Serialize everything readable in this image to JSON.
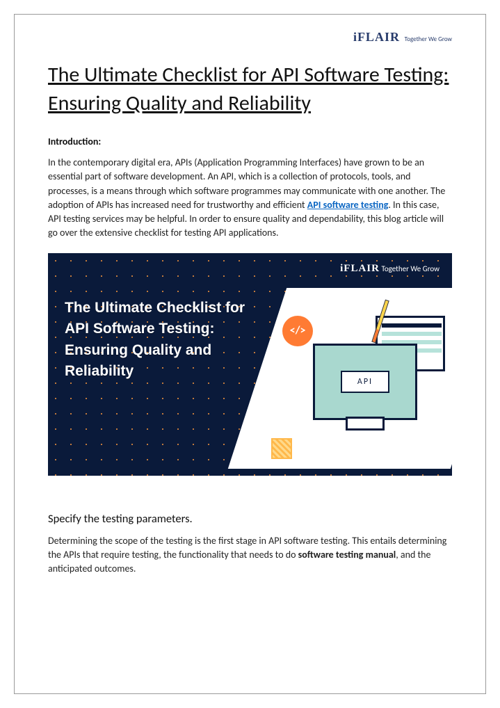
{
  "brand": {
    "name": "iFLAIR",
    "tagline": "Together We Grow"
  },
  "title": "The Ultimate Checklist for API Software Testing: Ensuring Quality and Reliability",
  "intro_label": "Introduction:",
  "intro": {
    "p1a": "In the contemporary digital era, APIs (Application Programming Interfaces) have grown to be an essential part of software development. An API, which is a collection of protocols, tools, and processes, is a means through which software programmes may communicate with one another. The adoption of APIs has increased need for trustworthy and efficient ",
    "link": "API software testing",
    "p1b": ". In this case, API testing services may be helpful. In order to ensure quality and dependability, this blog article will go over the extensive checklist for testing API applications."
  },
  "banner": {
    "title": "The Ultimate Checklist for API Software Testing: Ensuring Quality and Reliability",
    "api_label": "API",
    "code_glyph": "</>"
  },
  "section1": {
    "heading": "Specify the testing parameters.",
    "body_a": "Determining the scope of the testing is the first stage in API software testing. This entails determining the APIs that require testing, the functionality that needs to do ",
    "bold": "software testing manual",
    "body_b": ", and the anticipated outcomes."
  }
}
